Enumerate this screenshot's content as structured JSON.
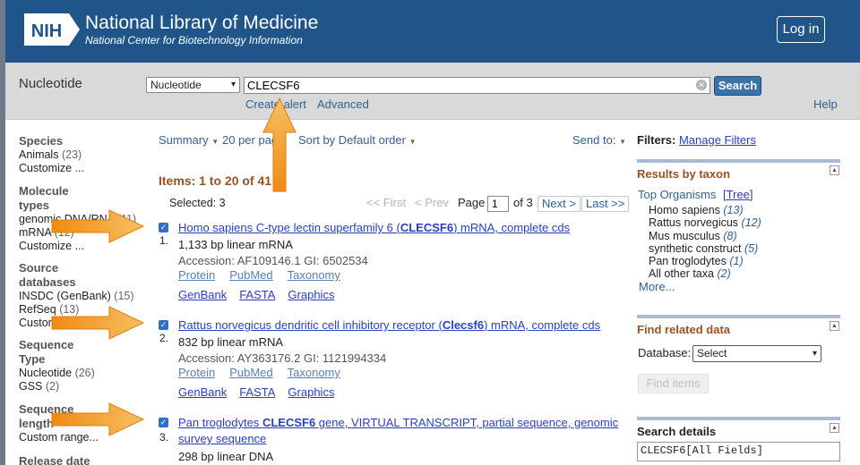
{
  "header": {
    "logo_text": "NIH",
    "title": "National Library of Medicine",
    "subtitle": "National Center for Biotechnology Information",
    "login_label": "Log in"
  },
  "search": {
    "db_title": "Nucleotide",
    "db_selected": "Nucleotide",
    "query": "CLECSF6",
    "search_label": "Search",
    "create_alert": "Create alert",
    "advanced": "Advanced",
    "help": "Help"
  },
  "sidebar": {
    "groups": [
      {
        "title": "Species",
        "items": [
          {
            "label": "Animals",
            "count": "(23)"
          },
          {
            "label": "Customize ...",
            "count": ""
          }
        ]
      },
      {
        "title": "Molecule types",
        "items": [
          {
            "label": "genomic DNA/RNA",
            "count": "(11)"
          },
          {
            "label": "mRNA",
            "count": "(12)"
          },
          {
            "label": "Customize ...",
            "count": ""
          }
        ]
      },
      {
        "title": "Source databases",
        "items": [
          {
            "label": "INSDC (GenBank)",
            "count": "(15)"
          },
          {
            "label": "RefSeq",
            "count": "(13)"
          },
          {
            "label": "Customize ...",
            "count": ""
          }
        ]
      },
      {
        "title": "Sequence Type",
        "items": [
          {
            "label": "Nucleotide",
            "count": "(26)"
          },
          {
            "label": "GSS",
            "count": "(2)"
          }
        ]
      },
      {
        "title": "Sequence length",
        "items": [
          {
            "label": "Custom range...",
            "count": ""
          }
        ]
      },
      {
        "title": "Release date",
        "items": []
      }
    ]
  },
  "toolbar": {
    "summary": "Summary",
    "per_page": "20 per page",
    "sort": "Sort by Default order",
    "send_to": "Send to:"
  },
  "results": {
    "items_title": "Items: 1 to 20 of 41",
    "selected": "Selected: 3",
    "pager": {
      "first": "<< First",
      "prev": "< Prev",
      "page_label": "Page",
      "page": "1",
      "of": "of 3",
      "next": "Next >",
      "last": "Last >>"
    },
    "items": [
      {
        "num": "1.",
        "title_pre": "Homo sapiens C-type lectin superfamily 6 (",
        "title_bold": "CLECSF6",
        "title_post": ") mRNA, complete cds",
        "desc": "1,133 bp linear mRNA",
        "accession": "Accession: AF109146.1   GI: 6502534",
        "links1": [
          "Protein",
          "PubMed",
          "Taxonomy"
        ],
        "links2": [
          "GenBank",
          "FASTA",
          "Graphics"
        ]
      },
      {
        "num": "2.",
        "title_pre": "Rattus norvegicus dendritic cell inhibitory receptor (",
        "title_bold": "Clecsf6",
        "title_post": ") mRNA, complete cds",
        "desc": "832 bp linear mRNA",
        "accession": "Accession: AY363176.2   GI: 1121994334",
        "links1": [
          "Protein",
          "PubMed",
          "Taxonomy"
        ],
        "links2": [
          "GenBank",
          "FASTA",
          "Graphics"
        ]
      },
      {
        "num": "3.",
        "title_pre": "Pan troglodytes ",
        "title_bold": "CLECSF6",
        "title_post": " gene, VIRTUAL TRANSCRIPT, partial sequence, genomic survey sequence",
        "desc": "298 bp linear DNA"
      }
    ]
  },
  "right": {
    "filters_label": "Filters:",
    "manage_filters": "Manage Filters",
    "taxon_title": "Results by taxon",
    "top_organisms": "Top Organisms",
    "tree": "[Tree]",
    "organisms": [
      {
        "name": "Homo sapiens",
        "count": "(13)"
      },
      {
        "name": "Rattus norvegicus",
        "count": "(12)"
      },
      {
        "name": "Mus musculus",
        "count": "(8)"
      },
      {
        "name": "synthetic construct",
        "count": "(5)"
      },
      {
        "name": "Pan troglodytes",
        "count": "(1)"
      },
      {
        "name": "All other taxa",
        "count": "(2)"
      }
    ],
    "more": "More...",
    "related_title": "Find related data",
    "database_label": "Database:",
    "database_selected": "Select",
    "find_items": "Find items",
    "details_title": "Search details",
    "details_query": "CLECSF6[All Fields]"
  },
  "colors": {
    "header_bg": "#20558a",
    "arrow": "#f39c1a",
    "link": "#2a3fc0",
    "section_title": "#995222"
  }
}
